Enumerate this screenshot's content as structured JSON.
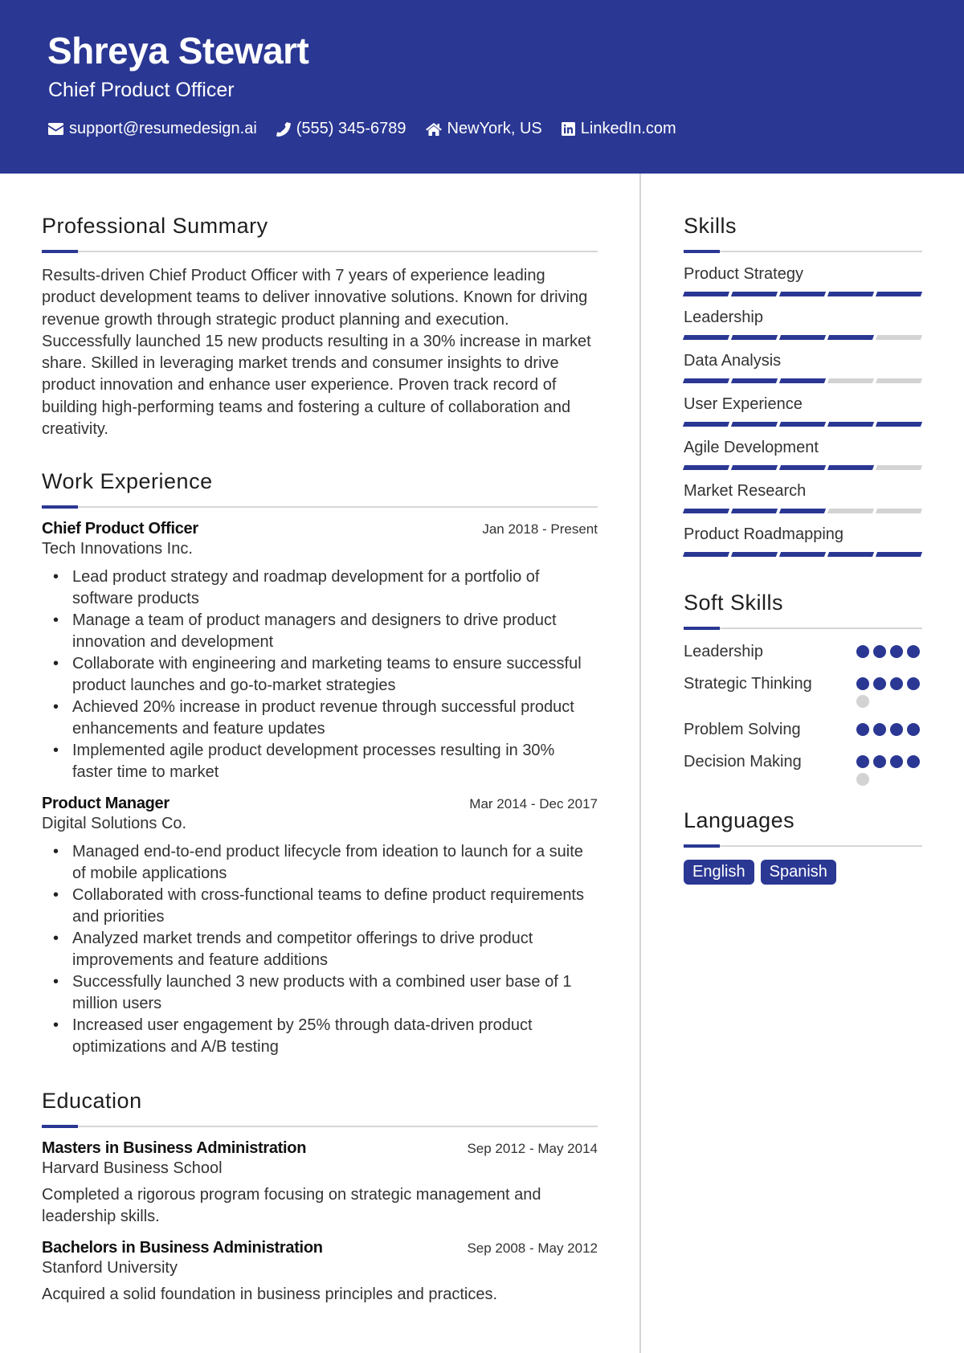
{
  "header": {
    "name": "Shreya Stewart",
    "title": "Chief Product Officer",
    "contacts": [
      {
        "icon": "envelope-icon",
        "text": "support@resumedesign.ai"
      },
      {
        "icon": "phone-icon",
        "text": "(555) 345-6789"
      },
      {
        "icon": "home-icon",
        "text": "NewYork, US"
      },
      {
        "icon": "linkedin-icon",
        "text": "LinkedIn.com"
      }
    ]
  },
  "colors": {
    "accent": "#2a3793",
    "inactive": "#d3d3d3"
  },
  "summary": {
    "heading": "Professional Summary",
    "text": "Results-driven Chief Product Officer with 7 years of experience leading product development teams to deliver innovative solutions. Known for driving revenue growth through strategic product planning and execution. Successfully launched 15 new products resulting in a 30% increase in market share. Skilled in leveraging market trends and consumer insights to drive product innovation and enhance user experience. Proven track record of building high-performing teams and fostering a culture of collaboration and creativity."
  },
  "experience": {
    "heading": "Work Experience",
    "jobs": [
      {
        "title": "Chief Product Officer",
        "date": "Jan 2018 - Present",
        "company": "Tech Innovations Inc.",
        "bullets": [
          "Lead product strategy and roadmap development for a portfolio of software products",
          "Manage a team of product managers and designers to drive product innovation and development",
          "Collaborate with engineering and marketing teams to ensure successful product launches and go-to-market strategies",
          "Achieved 20% increase in product revenue through successful product enhancements and feature updates",
          "Implemented agile product development processes resulting in 30% faster time to market"
        ]
      },
      {
        "title": "Product Manager",
        "date": "Mar 2014 - Dec 2017",
        "company": "Digital Solutions Co.",
        "bullets": [
          "Managed end-to-end product lifecycle from ideation to launch for a suite of mobile applications",
          "Collaborated with cross-functional teams to define product requirements and priorities",
          "Analyzed market trends and competitor offerings to drive product improvements and feature additions",
          "Successfully launched 3 new products with a combined user base of 1 million users",
          "Increased user engagement by 25% through data-driven product optimizations and A/B testing"
        ]
      }
    ]
  },
  "education": {
    "heading": "Education",
    "items": [
      {
        "degree": "Masters in Business Administration",
        "date": "Sep 2012 - May 2014",
        "school": "Harvard Business School",
        "desc": "Completed a rigorous program focusing on strategic management and leadership skills."
      },
      {
        "degree": "Bachelors in Business Administration",
        "date": "Sep 2008 - May 2012",
        "school": "Stanford University",
        "desc": "Acquired a solid foundation in business principles and practices."
      }
    ]
  },
  "skills": {
    "heading": "Skills",
    "max": 5,
    "items": [
      {
        "name": "Product Strategy",
        "level": 5
      },
      {
        "name": "Leadership",
        "level": 4
      },
      {
        "name": "Data Analysis",
        "level": 3
      },
      {
        "name": "User Experience",
        "level": 5
      },
      {
        "name": "Agile Development",
        "level": 4
      },
      {
        "name": "Market Research",
        "level": 3
      },
      {
        "name": "Product Roadmapping",
        "level": 5
      }
    ]
  },
  "soft_skills": {
    "heading": "Soft Skills",
    "max": 5,
    "items": [
      {
        "name": "Leadership",
        "level": 4,
        "dots": 4
      },
      {
        "name": "Strategic Thinking",
        "level": 4,
        "dots": 5
      },
      {
        "name": "Problem Solving",
        "level": 4,
        "dots": 4
      },
      {
        "name": "Decision Making",
        "level": 4,
        "dots": 5
      }
    ]
  },
  "languages": {
    "heading": "Languages",
    "items": [
      "English",
      "Spanish"
    ]
  }
}
